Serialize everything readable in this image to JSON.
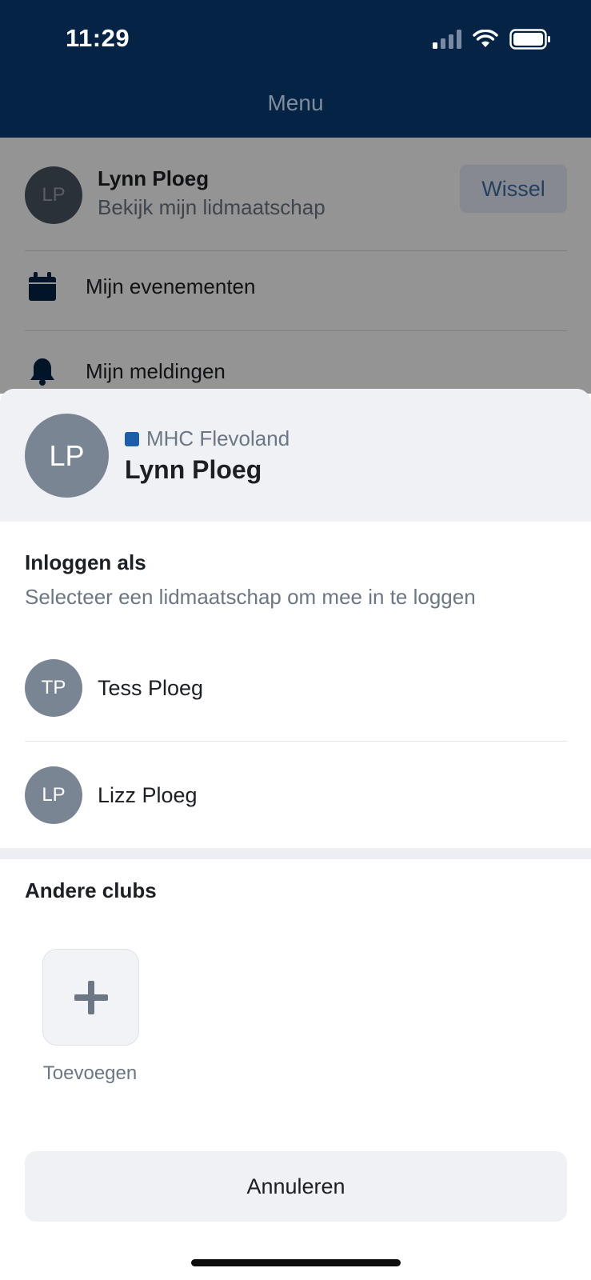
{
  "status_bar": {
    "time": "11:29"
  },
  "nav": {
    "title": "Menu"
  },
  "menu": {
    "profile": {
      "initials": "LP",
      "name": "Lynn Ploeg",
      "subtitle": "Bekijk mijn lidmaatschap",
      "switch_label": "Wissel"
    },
    "items": [
      {
        "label": "Mijn evenementen",
        "icon": "calendar-icon"
      },
      {
        "label": "Mijn meldingen",
        "icon": "bell-icon"
      }
    ]
  },
  "sheet": {
    "header": {
      "initials": "LP",
      "club": "MHC Flevoland",
      "name": "Lynn Ploeg",
      "club_color": "#1c5ea8"
    },
    "login": {
      "title": "Inloggen als",
      "subtitle": "Selecteer een lidmaatschap om mee in te loggen",
      "members": [
        {
          "initials": "TP",
          "name": "Tess Ploeg"
        },
        {
          "initials": "LP",
          "name": "Lizz Ploeg"
        }
      ]
    },
    "other_clubs": {
      "title": "Andere clubs",
      "add_label": "Toevoegen"
    },
    "cancel_label": "Annuleren"
  },
  "colors": {
    "nav_background": "#052445",
    "accent": "#1c5ea8"
  }
}
